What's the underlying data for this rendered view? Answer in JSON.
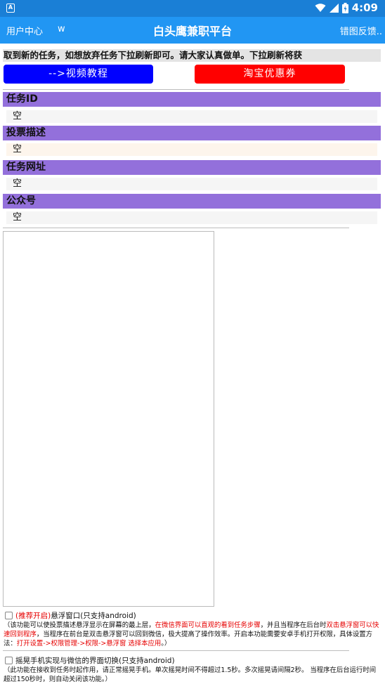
{
  "status_bar": {
    "time": "4:09",
    "app_icon_letter": "A"
  },
  "app_bar": {
    "left_link": "用户中心",
    "left_extra": "w",
    "title": "白头鹰兼职平台",
    "right_link": "错图反馈.."
  },
  "notice": "取到新的任务，如想放弃任务下拉刷新即可。请大家认真做单。下拉刷新将获",
  "buttons": {
    "video_tutorial": "-->视频教程",
    "taobao_coupon": "淘宝优惠券"
  },
  "sections": [
    {
      "label": "任务ID",
      "value": "空"
    },
    {
      "label": "投票描述",
      "value": "空"
    },
    {
      "label": "任务网址",
      "value": "空"
    },
    {
      "label": "公众号",
      "value": "空"
    }
  ],
  "options": {
    "float_window": {
      "tag": "(推荐开启)",
      "label": "悬浮窗口(只支持android)",
      "desc_1": "（该功能可以使投票描述悬浮显示在屏幕的最上层，",
      "desc_2_red": "在微信界面可以直观的看到任务步骤",
      "desc_3": "，并且当程序在后台时",
      "desc_4_red": "双击悬浮窗可以快速回到程序",
      "desc_5": "，当程序在前台是双击悬浮窗可以回到微信，极大提高了操作效率。开启本功能需要安卓手机打开权限，具体设置方法：",
      "desc_6_red": "打开设置->权限管理->权限->悬浮窗 选择本应用",
      "desc_7": "。）"
    },
    "shake_switch": {
      "label": "摇晃手机实现与微信的界面切换(只支持android)",
      "desc_1": "（此功能在接收到任务时起作用，请正常摇晃手机。单次摇晃时间不得超过1.5秒。多次摇晃请间隔2秒。 当程序在后台运行时间超过150秒时，则自动关闭该功能。）"
    }
  }
}
